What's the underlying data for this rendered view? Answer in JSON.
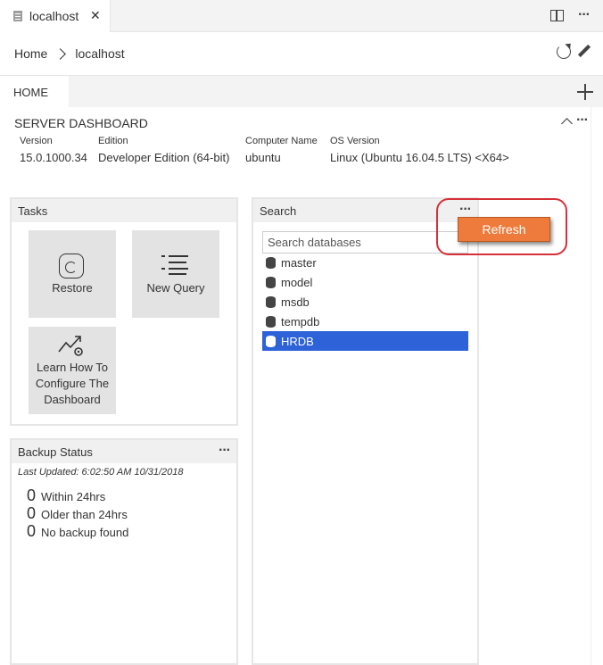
{
  "editor_tab": {
    "title": "localhost",
    "close": "✕"
  },
  "breadcrumb": {
    "home": "Home",
    "current": "localhost"
  },
  "dashboard_tab": {
    "label": "HOME"
  },
  "server": {
    "title": "SERVER DASHBOARD",
    "properties": [
      {
        "label": "Version",
        "value": "15.0.1000.34"
      },
      {
        "label": "Edition",
        "value": "Developer Edition (64-bit)"
      },
      {
        "label": "Computer Name",
        "value": "ubuntu"
      },
      {
        "label": "OS Version",
        "value": "Linux (Ubuntu 16.04.5 LTS) <X64>"
      }
    ]
  },
  "tasks": {
    "title": "Tasks",
    "items": [
      {
        "label": "Restore",
        "icon": "restore-icon"
      },
      {
        "label": "New Query",
        "icon": "new-query-icon"
      },
      {
        "label": "Learn How To Configure The Dashboard",
        "icon": "learn-dashboard-icon"
      }
    ]
  },
  "search": {
    "title": "Search",
    "placeholder": "Search databases",
    "databases": [
      {
        "name": "master",
        "selected": false
      },
      {
        "name": "model",
        "selected": false
      },
      {
        "name": "msdb",
        "selected": false
      },
      {
        "name": "tempdb",
        "selected": false
      },
      {
        "name": "HRDB",
        "selected": true
      }
    ],
    "more": "···"
  },
  "context_menu": {
    "refresh": "Refresh"
  },
  "backup": {
    "title": "Backup Status",
    "updated": "Last Updated: 6:02:50 AM 10/31/2018",
    "rows": [
      {
        "count": "0",
        "text": "Within 24hrs"
      },
      {
        "count": "0",
        "text": "Older than 24hrs"
      },
      {
        "count": "0",
        "text": "No backup found"
      }
    ],
    "more": "···"
  },
  "colors": {
    "accent": "#2d62d9",
    "menu": "#ee7b3c",
    "highlight": "#d63038"
  }
}
